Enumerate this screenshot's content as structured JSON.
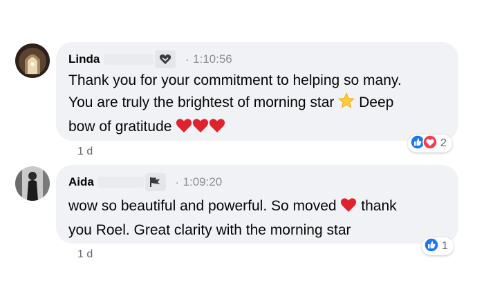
{
  "comments": [
    {
      "author": "Linda",
      "timestamp": "1:10:56",
      "badge_icon": "heart-shield-icon",
      "lines": [
        "Thank you for your commitment to helping so many.",
        "You are truly the brightest of morning star",
        "Deep",
        "bow of gratitude"
      ],
      "age": "1 d",
      "reaction_icons": [
        "like-icon",
        "love-icon"
      ],
      "reaction_count": "2"
    },
    {
      "author": "Aida",
      "timestamp": "1:09:20",
      "badge_icon": "flag-icon",
      "lines": [
        "wow so beautiful and powerful. So moved",
        "thank",
        "you Roel. Great clarity with the morning star"
      ],
      "age": "1 d",
      "reaction_icons": [
        "like-icon"
      ],
      "reaction_count": "1"
    }
  ],
  "colors": {
    "bubble": "#f0f2f5",
    "like_blue": "#1877f2",
    "love_red": "#f33e58",
    "heart_red": "#e0222e",
    "time_dot": "#e4413b"
  }
}
